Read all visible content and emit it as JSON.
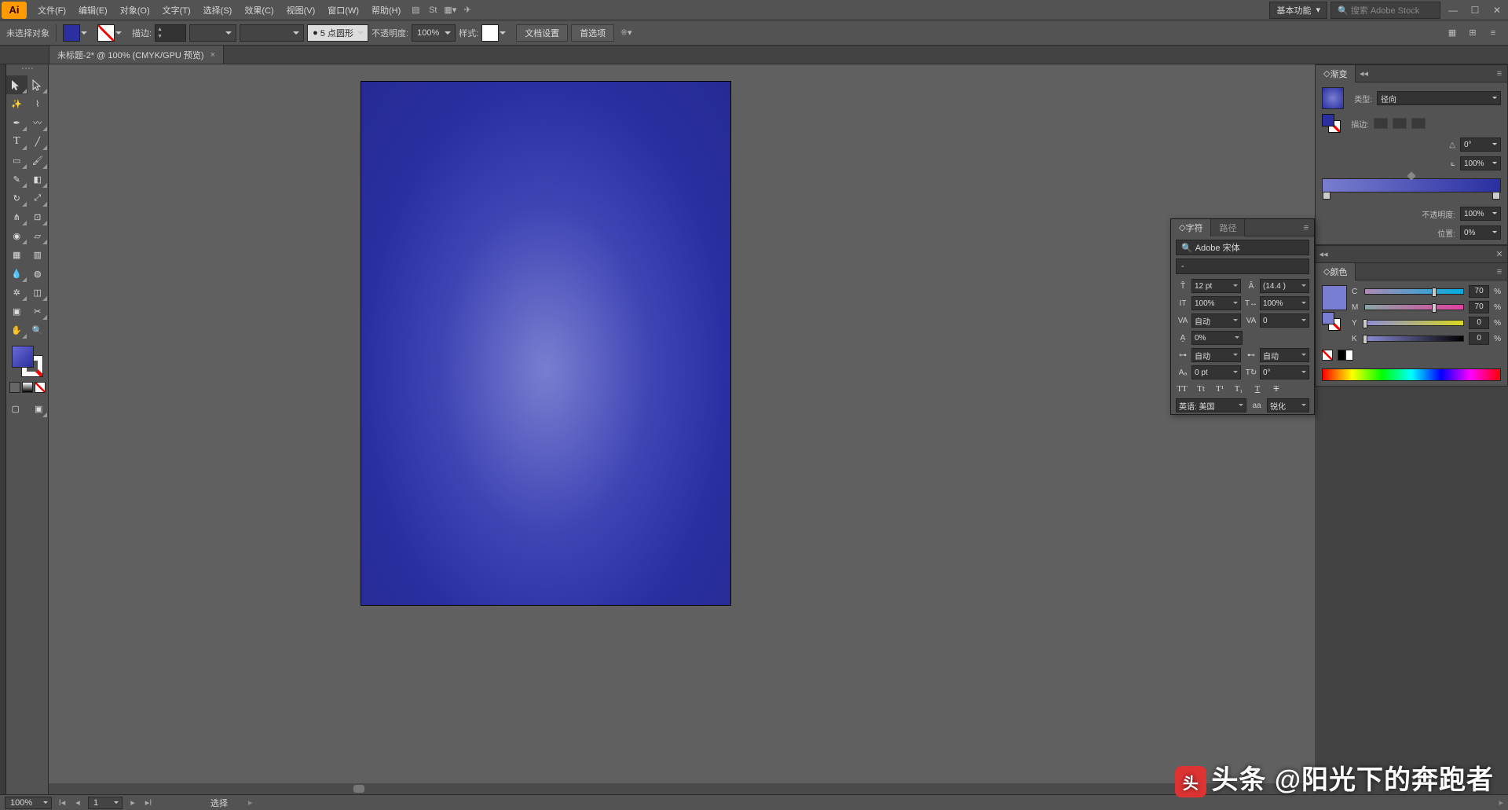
{
  "app": {
    "logo": "Ai"
  },
  "menus": [
    "文件(F)",
    "编辑(E)",
    "对象(O)",
    "文字(T)",
    "选择(S)",
    "效果(C)",
    "视图(V)",
    "窗口(W)",
    "帮助(H)"
  ],
  "workspace": "基本功能",
  "search_placeholder": "搜索 Adobe Stock",
  "control": {
    "sel_label": "未选择对象",
    "stroke_label": "描边:",
    "stroke_weight": "",
    "brush_width": "5 点圆形",
    "opacity_label": "不透明度:",
    "opacity_val": "100%",
    "style_label": "样式:",
    "doc_setup": "文档设置",
    "prefs": "首选项"
  },
  "tab": {
    "title": "未标题-2* @ 100% (CMYK/GPU 预览)"
  },
  "gradient": {
    "title": "渐变",
    "type_label": "类型:",
    "type_val": "径向",
    "stroke_label": "描边:",
    "angle_label": "△",
    "angle_val": "0°",
    "ratio_label": "⟀",
    "ratio_val": "100%",
    "opacity_label": "不透明度:",
    "opacity_val": "100%",
    "pos_label": "位置:",
    "pos_val": "0%"
  },
  "color": {
    "title": "颜色",
    "c": "70",
    "m": "70",
    "y": "0",
    "k": "0"
  },
  "char": {
    "tab1": "字符",
    "tab2": "路径",
    "font": "Adobe 宋体",
    "style": "-",
    "size": "12 pt",
    "leading": "(14.4 )",
    "hscale": "100%",
    "vscale": "100%",
    "kerning": "自动",
    "tracking": "0",
    "baseline": "0%",
    "a1": "自动",
    "a2": "自动",
    "shift": "0 pt",
    "rotate": "0°",
    "lang_label": "英语: 美国",
    "aa_prefix": "aa",
    "aa": "锐化"
  },
  "status": {
    "zoom": "100%",
    "page": "1",
    "tool": "选择"
  },
  "watermark": "头条 @阳光下的奔跑者"
}
